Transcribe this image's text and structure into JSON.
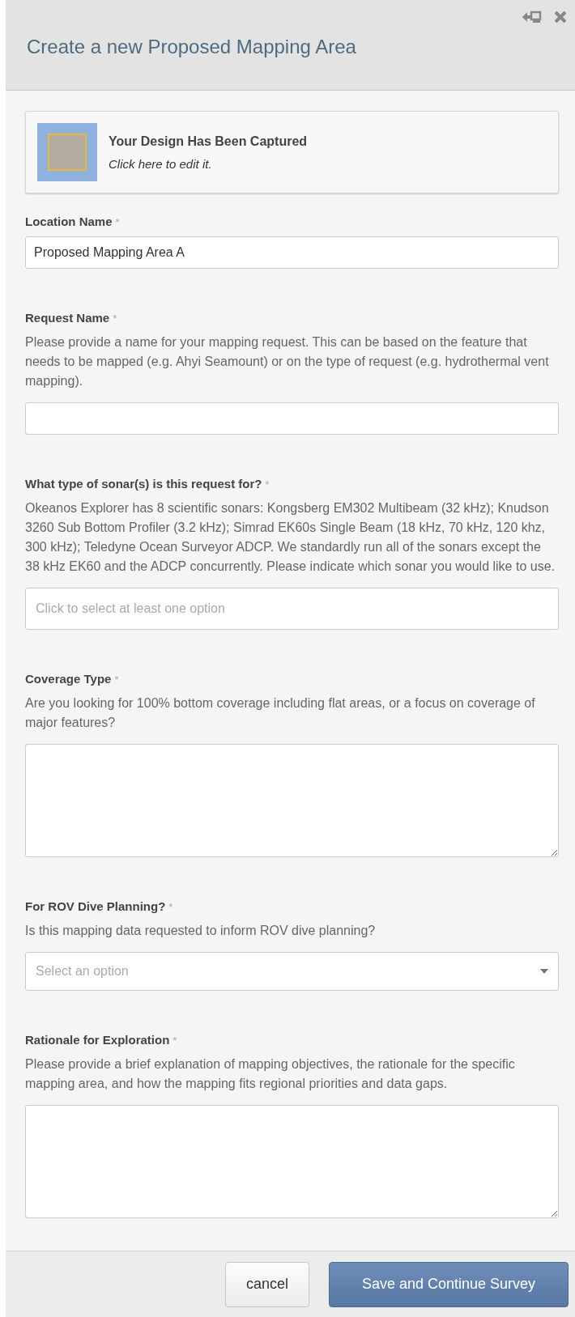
{
  "dialog": {
    "title": "Create a new Proposed Mapping Area"
  },
  "design_card": {
    "title": "Your Design Has Been Captured",
    "subtitle": "Click here to edit it."
  },
  "fields": [
    {
      "kind": "text",
      "label": "Location Name",
      "required_mark": "*",
      "value": "Proposed Mapping Area A"
    },
    {
      "kind": "text",
      "label": "Request Name",
      "required_mark": "*",
      "help": "Please provide a name for your mapping request. This can be based on the feature that needs to be mapped (e.g. Ahyi Seamount) or on the type of request (e.g. hydrothermal vent mapping)."
    },
    {
      "kind": "multiselect",
      "label": "What type of sonar(s) is this request for?",
      "required_mark": "*",
      "help": "Okeanos Explorer has 8 scientific sonars: Kongsberg EM302 Multibeam (32 kHz); Knudson 3260 Sub Bottom Profiler (3.2 kHz); Simrad EK60s Single Beam (18 kHz, 70 kHz, 120 khz, 300 kHz); Teledyne Ocean Surveyor ADCP. We standardly run all of the sonars except the 38 kHz EK60 and the ADCP concurrently. Please indicate which sonar you would like to use.",
      "placeholder": "Click to select at least one option"
    },
    {
      "kind": "textarea",
      "label": "Coverage Type",
      "required_mark": "*",
      "help": "Are you looking for 100% bottom coverage including flat areas, or a focus on coverage of major features?"
    },
    {
      "kind": "select",
      "label": "For ROV Dive Planning?",
      "required_mark": "*",
      "help": "Is this mapping data requested to inform ROV dive planning?",
      "placeholder": "Select an option"
    },
    {
      "kind": "textarea",
      "label": "Rationale for Exploration",
      "required_mark": "*",
      "help": "Please provide a brief explanation of mapping objectives, the rationale for the specific mapping area, and how the mapping fits regional priorities and data gaps."
    }
  ],
  "buttons": [
    {
      "label": "cancel",
      "kind": "secondary"
    },
    {
      "label": "Save and Continue Survey",
      "kind": "primary"
    }
  ]
}
